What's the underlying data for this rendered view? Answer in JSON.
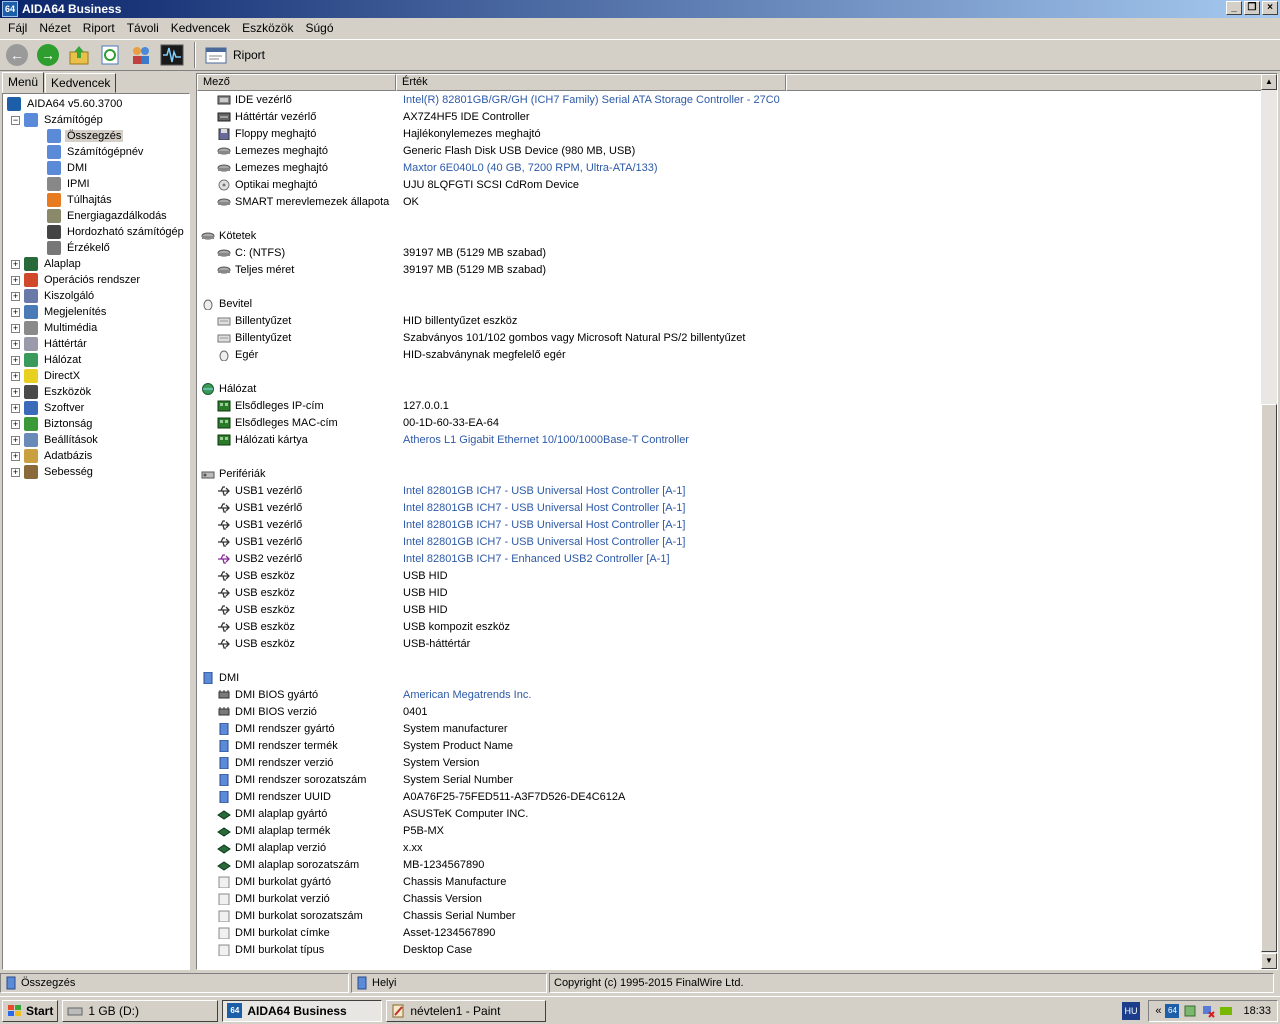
{
  "window": {
    "title": "AIDA64 Business",
    "app_icon": "64"
  },
  "menu": [
    "Fájl",
    "Nézet",
    "Riport",
    "Távoli",
    "Kedvencek",
    "Eszközök",
    "Súgó"
  ],
  "toolbar": {
    "report_label": "Riport"
  },
  "tabs": [
    "Menü",
    "Kedvencek"
  ],
  "tree": {
    "root": "AIDA64 v5.60.3700",
    "computer": "Számítógép",
    "computer_children": [
      "Összegzés",
      "Számítógépnév",
      "DMI",
      "IPMI",
      "Túlhajtás",
      "Energiagazdálkodás",
      "Hordozható számítógép",
      "Érzékelő"
    ],
    "sections": [
      "Alaplap",
      "Operációs rendszer",
      "Kiszolgáló",
      "Megjelenítés",
      "Multimédia",
      "Háttértár",
      "Hálózat",
      "DirectX",
      "Eszközök",
      "Szoftver",
      "Biztonság",
      "Beállítások",
      "Adatbázis",
      "Sebesség"
    ]
  },
  "list": {
    "headers": [
      "Mező",
      "Érték"
    ],
    "rows": [
      {
        "t": "item",
        "icon": "ide",
        "f": "IDE vezérlő",
        "v": "Intel(R) 82801GB/GR/GH (ICH7 Family) Serial ATA Storage Controller - 27C0",
        "link": true
      },
      {
        "t": "item",
        "icon": "storage",
        "f": "Háttértár vezérlő",
        "v": "AX7Z4HF5 IDE Controller"
      },
      {
        "t": "item",
        "icon": "floppy",
        "f": "Floppy meghajtó",
        "v": "Hajlékonylemezes meghajtó"
      },
      {
        "t": "item",
        "icon": "disk",
        "f": "Lemezes meghajtó",
        "v": "Generic Flash Disk USB Device  (980 MB, USB)"
      },
      {
        "t": "item",
        "icon": "disk",
        "f": "Lemezes meghajtó",
        "v": "Maxtor 6E040L0  (40 GB, 7200 RPM, Ultra-ATA/133)",
        "link": true
      },
      {
        "t": "item",
        "icon": "optical",
        "f": "Optikai meghajtó",
        "v": "UJU 8LQFGTI SCSI CdRom Device"
      },
      {
        "t": "item",
        "icon": "disk",
        "f": "SMART merevlemezek állapota",
        "v": "OK"
      },
      {
        "t": "blank"
      },
      {
        "t": "cat",
        "icon": "disk",
        "f": "Kötetek"
      },
      {
        "t": "item",
        "icon": "disk",
        "f": "C: (NTFS)",
        "v": "39197 MB (5129 MB szabad)"
      },
      {
        "t": "item",
        "icon": "disk",
        "f": "Teljes méret",
        "v": "39197 MB (5129 MB szabad)"
      },
      {
        "t": "blank"
      },
      {
        "t": "cat",
        "icon": "mouse",
        "f": "Bevitel"
      },
      {
        "t": "item",
        "icon": "keyboard",
        "f": "Billentyűzet",
        "v": "HID billentyűzet eszköz"
      },
      {
        "t": "item",
        "icon": "keyboard",
        "f": "Billentyűzet",
        "v": "Szabványos 101/102 gombos vagy Microsoft Natural PS/2 billentyűzet"
      },
      {
        "t": "item",
        "icon": "mouse",
        "f": "Egér",
        "v": "HID-szabványnak megfelelő egér"
      },
      {
        "t": "blank"
      },
      {
        "t": "cat",
        "icon": "globe",
        "f": "Hálózat"
      },
      {
        "t": "item",
        "icon": "network",
        "f": "Elsődleges IP-cím",
        "v": "127.0.0.1"
      },
      {
        "t": "item",
        "icon": "network",
        "f": "Elsődleges MAC-cím",
        "v": "00-1D-60-33-EA-64"
      },
      {
        "t": "item",
        "icon": "network",
        "f": "Hálózati kártya",
        "v": "Atheros L1 Gigabit Ethernet 10/100/1000Base-T Controller",
        "link": true
      },
      {
        "t": "blank"
      },
      {
        "t": "cat",
        "icon": "periph",
        "f": "Perifériák"
      },
      {
        "t": "item",
        "icon": "usb",
        "f": "USB1 vezérlő",
        "v": "Intel 82801GB ICH7 - USB Universal Host Controller [A-1]",
        "link": true
      },
      {
        "t": "item",
        "icon": "usb",
        "f": "USB1 vezérlő",
        "v": "Intel 82801GB ICH7 - USB Universal Host Controller [A-1]",
        "link": true
      },
      {
        "t": "item",
        "icon": "usb",
        "f": "USB1 vezérlő",
        "v": "Intel 82801GB ICH7 - USB Universal Host Controller [A-1]",
        "link": true
      },
      {
        "t": "item",
        "icon": "usb",
        "f": "USB1 vezérlő",
        "v": "Intel 82801GB ICH7 - USB Universal Host Controller [A-1]",
        "link": true
      },
      {
        "t": "item",
        "icon": "usb2",
        "f": "USB2 vezérlő",
        "v": "Intel 82801GB ICH7 - Enhanced USB2 Controller [A-1]",
        "link": true
      },
      {
        "t": "item",
        "icon": "usb",
        "f": "USB eszköz",
        "v": "USB HID"
      },
      {
        "t": "item",
        "icon": "usb",
        "f": "USB eszköz",
        "v": "USB HID"
      },
      {
        "t": "item",
        "icon": "usb",
        "f": "USB eszköz",
        "v": "USB HID"
      },
      {
        "t": "item",
        "icon": "usb",
        "f": "USB eszköz",
        "v": "USB kompozit eszköz"
      },
      {
        "t": "item",
        "icon": "usb",
        "f": "USB eszköz",
        "v": "USB-háttértár"
      },
      {
        "t": "blank"
      },
      {
        "t": "cat",
        "icon": "computer",
        "f": "DMI"
      },
      {
        "t": "item",
        "icon": "chip",
        "f": "DMI BIOS gyártó",
        "v": "American Megatrends Inc.",
        "link": true
      },
      {
        "t": "item",
        "icon": "chip",
        "f": "DMI BIOS verzió",
        "v": "0401"
      },
      {
        "t": "item",
        "icon": "computer",
        "f": "DMI rendszer gyártó",
        "v": "System manufacturer"
      },
      {
        "t": "item",
        "icon": "computer",
        "f": "DMI rendszer termék",
        "v": "System Product Name"
      },
      {
        "t": "item",
        "icon": "computer",
        "f": "DMI rendszer verzió",
        "v": "System Version"
      },
      {
        "t": "item",
        "icon": "computer",
        "f": "DMI rendszer sorozatszám",
        "v": "System Serial Number"
      },
      {
        "t": "item",
        "icon": "computer",
        "f": "DMI rendszer UUID",
        "v": "A0A76F25-75FED511-A3F7D526-DE4C612A"
      },
      {
        "t": "item",
        "icon": "board",
        "f": "DMI alaplap gyártó",
        "v": "ASUSTeK Computer INC."
      },
      {
        "t": "item",
        "icon": "board",
        "f": "DMI alaplap termék",
        "v": "P5B-MX"
      },
      {
        "t": "item",
        "icon": "board",
        "f": "DMI alaplap verzió",
        "v": "x.xx"
      },
      {
        "t": "item",
        "icon": "board",
        "f": "DMI alaplap sorozatszám",
        "v": "MB-1234567890"
      },
      {
        "t": "item",
        "icon": "case",
        "f": "DMI burkolat gyártó",
        "v": "Chassis Manufacture"
      },
      {
        "t": "item",
        "icon": "case",
        "f": "DMI burkolat verzió",
        "v": "Chassis Version"
      },
      {
        "t": "item",
        "icon": "case",
        "f": "DMI burkolat sorozatszám",
        "v": "Chassis Serial Number"
      },
      {
        "t": "item",
        "icon": "case",
        "f": "DMI burkolat címke",
        "v": "Asset-1234567890"
      },
      {
        "t": "item",
        "icon": "case",
        "f": "DMI burkolat típus",
        "v": "Desktop Case"
      }
    ]
  },
  "status": [
    "Összegzés",
    "Helyi",
    "Copyright (c) 1995-2015 FinalWire Ltd."
  ],
  "taskbar": {
    "start": "Start",
    "tasks": [
      "1 GB (D:)",
      "AIDA64 Business",
      "névtelen1 - Paint"
    ],
    "lang": "HU",
    "clock": "18:33"
  },
  "colors": {
    "link": "#2d5aa8",
    "titlebar_start": "#0a246a",
    "titlebar_end": "#a6caf0"
  }
}
